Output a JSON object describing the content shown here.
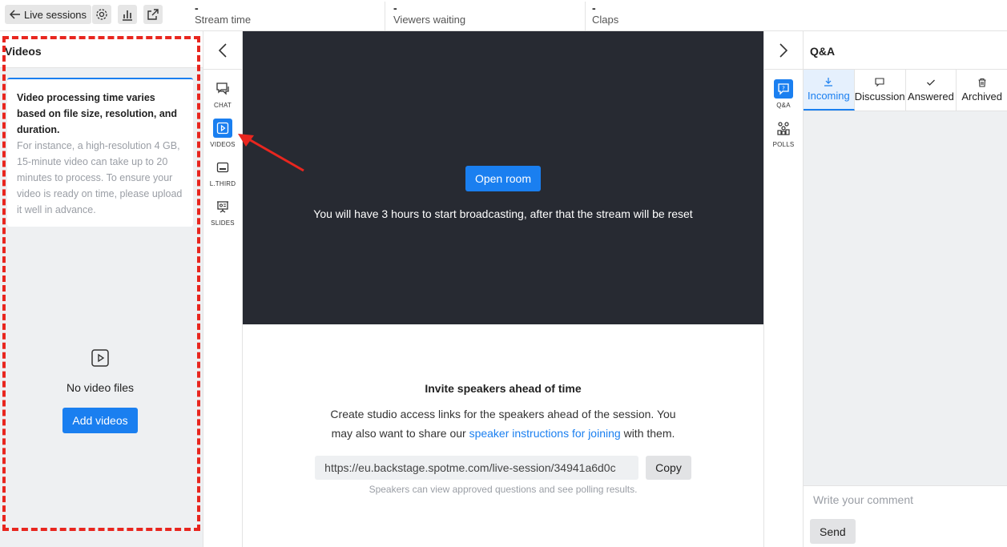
{
  "topbar": {
    "back_label": "Live sessions",
    "stats": [
      {
        "value": "-",
        "label": "Stream time"
      },
      {
        "value": "-",
        "label": "Viewers waiting"
      },
      {
        "value": "-",
        "label": "Claps"
      }
    ]
  },
  "videos_panel": {
    "title": "Videos",
    "info_bold": "Video processing time varies based on file size, resolution, and duration.",
    "info_muted": "For instance, a high-resolution 4 GB, 15-minute video can take up to 20 minutes to process. To ensure your video is ready on time, please upload it well in advance.",
    "empty_text": "No video files",
    "add_button": "Add videos"
  },
  "left_rail": {
    "items": [
      {
        "label": "CHAT",
        "icon": "chat-icon"
      },
      {
        "label": "VIDEOS",
        "icon": "video-icon",
        "active": true
      },
      {
        "label": "L.THIRD",
        "icon": "lower-third-icon"
      },
      {
        "label": "SLIDES",
        "icon": "slides-icon"
      }
    ]
  },
  "stage": {
    "open_button": "Open room",
    "message": "You will have 3 hours to start broadcasting, after that the stream will be reset"
  },
  "invite": {
    "title": "Invite speakers ahead of time",
    "desc_before": "Create studio access links for the speakers ahead of the session. You may also want to share our ",
    "desc_link": "speaker instructions for joining",
    "desc_after": " with them.",
    "link_value": "https://eu.backstage.spotme.com/live-session/34941a6d0c",
    "copy_label": "Copy",
    "note": "Speakers can view approved questions and see polling results."
  },
  "right_rail": {
    "items": [
      {
        "label": "Q&A",
        "icon": "qa-icon",
        "active": true
      },
      {
        "label": "POLLS",
        "icon": "polls-icon"
      }
    ]
  },
  "qa_panel": {
    "title": "Q&A",
    "tabs": [
      {
        "label": "Incoming",
        "icon": "download-icon",
        "active": true
      },
      {
        "label": "Discussion",
        "icon": "comment-icon"
      },
      {
        "label": "Answered",
        "icon": "check-icon"
      },
      {
        "label": "Archived",
        "icon": "trash-icon"
      }
    ],
    "comment_placeholder": "Write your comment",
    "send_label": "Send"
  },
  "colors": {
    "accent": "#1a7ff0",
    "stage_bg": "#272a32",
    "annotation": "#e8261f"
  }
}
